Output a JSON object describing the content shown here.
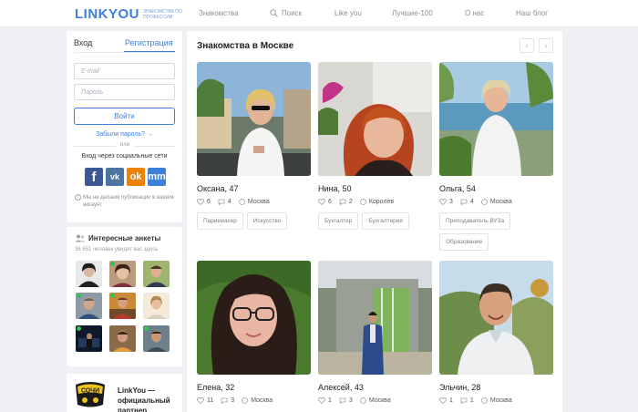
{
  "header": {
    "logo": "LINKYOU",
    "logo_sub": "знакомства по профессии",
    "nav": [
      "Знакомства",
      "Поиск",
      "Like you",
      "Лучшие-100",
      "О нас",
      "Наш блог"
    ]
  },
  "login": {
    "tab_login": "Вход",
    "tab_register": "Регистрация",
    "email_placeholder": "E-mail",
    "password_placeholder": "Пароль",
    "submit": "Войти",
    "forgot": "Забыли пароль? →",
    "or": "или",
    "social_title": "Вход через социальные сети",
    "social": [
      "f",
      "vk",
      "ok",
      "mm"
    ],
    "privacy": "Мы не делаем публикации в вашем аккаунт"
  },
  "interesting": {
    "title": "Интересные анкеты",
    "subtitle": "36 651 человек увидят вас здесь"
  },
  "partner": {
    "logo_text": "СОЧИ",
    "text": "LinkYou — официальный партнер"
  },
  "main": {
    "title": "Знакомства в Москве",
    "profiles": [
      {
        "name": "Оксана, 47",
        "likes": "6",
        "comments": "4",
        "city": "Москва",
        "tags": [
          "Парикмахер",
          "Искусство"
        ]
      },
      {
        "name": "Нина, 50",
        "likes": "6",
        "comments": "2",
        "city": "Королев",
        "tags": [
          "Бухгалтер",
          "Бухгалтерия"
        ]
      },
      {
        "name": "Ольга, 54",
        "likes": "3",
        "comments": "4",
        "city": "Москва",
        "tags": [
          "Преподаватель ВУЗа",
          "Образование"
        ]
      },
      {
        "name": "Елена, 32",
        "likes": "11",
        "comments": "3",
        "city": "Москва",
        "tags": []
      },
      {
        "name": "Алексей, 43",
        "likes": "1",
        "comments": "3",
        "city": "Москва",
        "tags": []
      },
      {
        "name": "Эльчин, 28",
        "likes": "1",
        "comments": "1",
        "city": "Москва",
        "tags": []
      }
    ]
  }
}
